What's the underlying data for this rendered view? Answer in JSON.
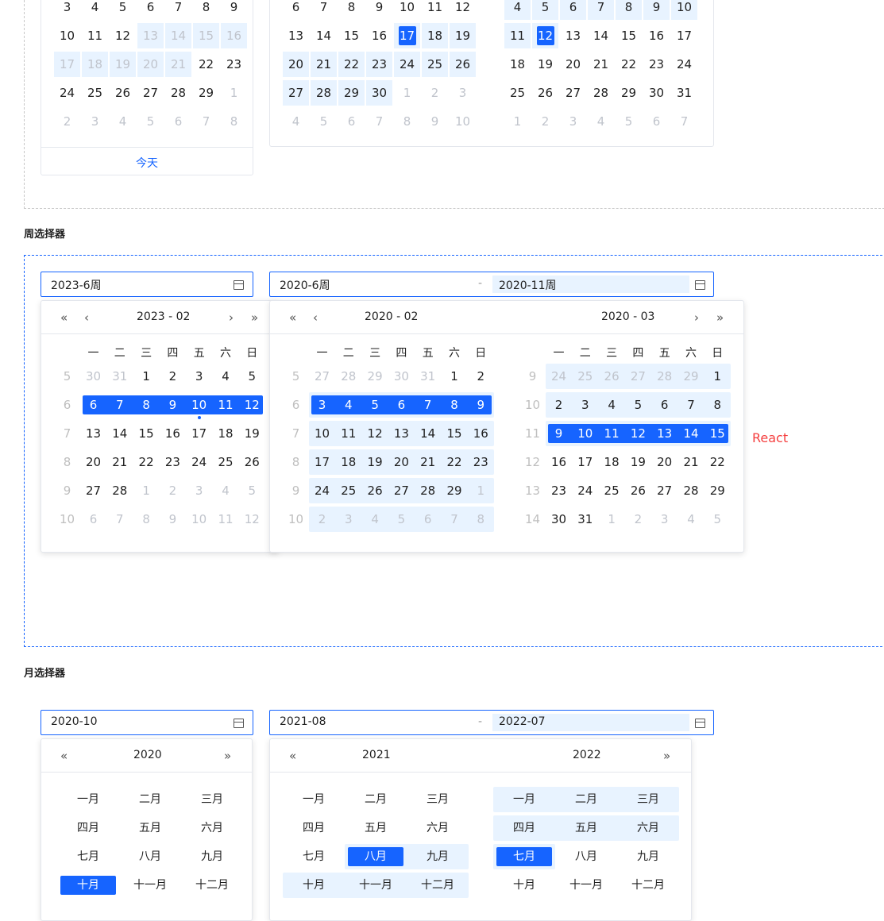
{
  "top_panels": {
    "today_label": "今天",
    "left_rows": [
      [
        "3",
        "4",
        "5",
        "6",
        "7",
        "8",
        "9"
      ],
      [
        "10",
        "11",
        "12",
        "13",
        "14",
        "15",
        "16"
      ],
      [
        "17",
        "18",
        "19",
        "20",
        "21",
        "22",
        "23"
      ],
      [
        "24",
        "25",
        "26",
        "27",
        "28",
        "29",
        "1"
      ],
      [
        "2",
        "3",
        "4",
        "5",
        "6",
        "7",
        "8"
      ]
    ],
    "mid_rows": [
      [
        "6",
        "7",
        "8",
        "9",
        "10",
        "11",
        "12"
      ],
      [
        "13",
        "14",
        "15",
        "16",
        "17",
        "18",
        "19"
      ],
      [
        "20",
        "21",
        "22",
        "23",
        "24",
        "25",
        "26"
      ],
      [
        "27",
        "28",
        "29",
        "30",
        "1",
        "2",
        "3"
      ],
      [
        "4",
        "5",
        "6",
        "7",
        "8",
        "9",
        "10"
      ]
    ],
    "right_rows": [
      [
        "4",
        "5",
        "6",
        "7",
        "8",
        "9",
        "10"
      ],
      [
        "11",
        "12",
        "13",
        "14",
        "15",
        "16",
        "17"
      ],
      [
        "18",
        "19",
        "20",
        "21",
        "22",
        "23",
        "24"
      ],
      [
        "25",
        "26",
        "27",
        "28",
        "29",
        "30",
        "31"
      ],
      [
        "1",
        "2",
        "3",
        "4",
        "5",
        "6",
        "7"
      ]
    ]
  },
  "week_section": {
    "label": "周选择器",
    "single_value": "2023-6周",
    "range_start": "2020-6周",
    "range_sep": "-",
    "range_end": "2020-11周",
    "react_label": "React",
    "weekdays": [
      "一",
      "二",
      "三",
      "四",
      "五",
      "六",
      "日"
    ],
    "single_title": "2023 - 02",
    "range_title_left": "2020 - 02",
    "range_title_right": "2020 - 03",
    "single_weeks": [
      "5",
      "6",
      "7",
      "8",
      "9",
      "10"
    ],
    "single_rows": [
      [
        "30",
        "31",
        "1",
        "2",
        "3",
        "4",
        "5"
      ],
      [
        "6",
        "7",
        "8",
        "9",
        "10",
        "11",
        "12"
      ],
      [
        "13",
        "14",
        "15",
        "16",
        "17",
        "18",
        "19"
      ],
      [
        "20",
        "21",
        "22",
        "23",
        "24",
        "25",
        "26"
      ],
      [
        "27",
        "28",
        "1",
        "2",
        "3",
        "4",
        "5"
      ],
      [
        "6",
        "7",
        "8",
        "9",
        "10",
        "11",
        "12"
      ]
    ],
    "left_weeks": [
      "5",
      "6",
      "7",
      "8",
      "9",
      "10"
    ],
    "left_rows": [
      [
        "27",
        "28",
        "29",
        "30",
        "31",
        "1",
        "2"
      ],
      [
        "3",
        "4",
        "5",
        "6",
        "7",
        "8",
        "9"
      ],
      [
        "10",
        "11",
        "12",
        "13",
        "14",
        "15",
        "16"
      ],
      [
        "17",
        "18",
        "19",
        "20",
        "21",
        "22",
        "23"
      ],
      [
        "24",
        "25",
        "26",
        "27",
        "28",
        "29",
        "1"
      ],
      [
        "2",
        "3",
        "4",
        "5",
        "6",
        "7",
        "8"
      ]
    ],
    "right_weeks": [
      "9",
      "10",
      "11",
      "12",
      "13",
      "14"
    ],
    "right_rows": [
      [
        "24",
        "25",
        "26",
        "27",
        "28",
        "29",
        "1"
      ],
      [
        "2",
        "3",
        "4",
        "5",
        "6",
        "7",
        "8"
      ],
      [
        "9",
        "10",
        "11",
        "12",
        "13",
        "14",
        "15"
      ],
      [
        "16",
        "17",
        "18",
        "19",
        "20",
        "21",
        "22"
      ],
      [
        "23",
        "24",
        "25",
        "26",
        "27",
        "28",
        "29"
      ],
      [
        "30",
        "31",
        "1",
        "2",
        "3",
        "4",
        "5"
      ]
    ]
  },
  "month_section": {
    "label": "月选择器",
    "single_value": "2020-10",
    "range_start": "2021-08",
    "range_sep": "-",
    "range_end": "2022-07",
    "single_year": "2020",
    "range_year_left": "2021",
    "range_year_right": "2022",
    "months": [
      "一月",
      "二月",
      "三月",
      "四月",
      "五月",
      "六月",
      "七月",
      "八月",
      "九月",
      "十月",
      "十一月",
      "十二月"
    ]
  },
  "colors": {
    "accent": "#1664ff",
    "range_bg": "#e8f3ff",
    "muted": "#c0c4cc",
    "react": "#f53f3f"
  }
}
